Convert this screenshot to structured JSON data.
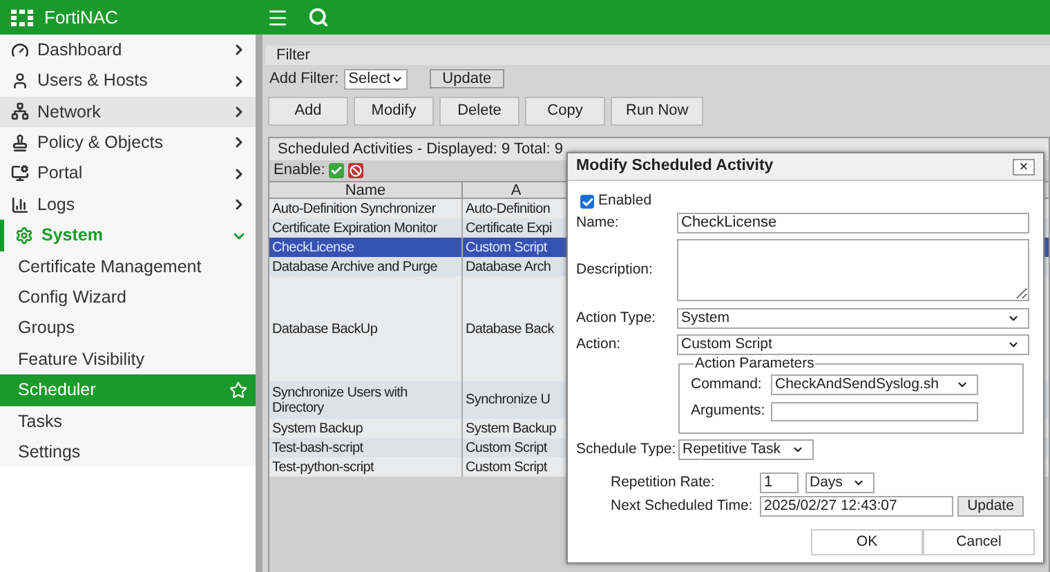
{
  "app": {
    "title": "FortiNAC"
  },
  "sidebar": {
    "items": [
      {
        "label": "Dashboard",
        "highlighted": false,
        "expanded": false
      },
      {
        "label": "Users & Hosts",
        "highlighted": false,
        "expanded": false
      },
      {
        "label": "Network",
        "highlighted": true,
        "expanded": false
      },
      {
        "label": "Policy & Objects",
        "highlighted": false,
        "expanded": false
      },
      {
        "label": "Portal",
        "highlighted": false,
        "expanded": false
      },
      {
        "label": "Logs",
        "highlighted": false,
        "expanded": false
      },
      {
        "label": "System",
        "highlighted": false,
        "expanded": true,
        "children": [
          {
            "label": "Certificate Management",
            "selected": false
          },
          {
            "label": "Config Wizard",
            "selected": false
          },
          {
            "label": "Groups",
            "selected": false
          },
          {
            "label": "Feature Visibility",
            "selected": false
          },
          {
            "label": "Scheduler",
            "selected": true
          },
          {
            "label": "Tasks",
            "selected": false
          },
          {
            "label": "Settings",
            "selected": false
          }
        ]
      }
    ]
  },
  "filter": {
    "title": "Filter",
    "add_filter_label": "Add Filter:",
    "select": "Select",
    "update_button": "Update"
  },
  "toolbar": [
    "Add",
    "Modify",
    "Delete",
    "Copy",
    "Run Now"
  ],
  "table": {
    "caption": "Scheduled Activities - Displayed: 9 Total: 9",
    "enable_label": "Enable:",
    "columns": [
      "Name",
      "A"
    ],
    "rows": [
      {
        "cells": [
          "Auto-Definition Synchronizer",
          "Auto-Definition"
        ],
        "selected": false
      },
      {
        "cells": [
          "Certificate Expiration Monitor",
          "Certificate Expi"
        ],
        "selected": false
      },
      {
        "cells": [
          "CheckLicense",
          "Custom Script"
        ],
        "selected": true
      },
      {
        "cells": [
          "Database Archive and Purge",
          "Database Arch"
        ],
        "selected": false
      },
      {
        "cells": [
          "Database BackUp",
          "Database Back"
        ],
        "selected": false
      },
      {
        "cells": [
          "Synchronize Users with Directory",
          "Synchronize U"
        ],
        "selected": false
      },
      {
        "cells": [
          "System Backup",
          "System Backup"
        ],
        "selected": false
      },
      {
        "cells": [
          "Test-bash-script",
          "Custom Script"
        ],
        "selected": false
      },
      {
        "cells": [
          "Test-python-script",
          "Custom Script"
        ],
        "selected": false
      }
    ]
  },
  "dialog": {
    "title": "Modify Scheduled Activity",
    "close": "×",
    "enabled": {
      "label": "Enabled",
      "checked": true
    },
    "name": {
      "label": "Name:",
      "value": "CheckLicense"
    },
    "description": {
      "label": "Description:"
    },
    "action_type": {
      "label": "Action Type:",
      "value": "System"
    },
    "action": {
      "label": "Action:",
      "value": "Custom Script"
    },
    "action_parameters": {
      "legend": "Action Parameters",
      "command": {
        "label": "Command:",
        "value": "CheckAndSendSyslog.sh"
      },
      "arguments": {
        "label": "Arguments:"
      }
    },
    "schedule_type": {
      "label": "Schedule Type:",
      "value": "Repetitive Task"
    },
    "repetition_rate": {
      "label": "Repetition Rate:",
      "value": "1",
      "unit": "Days"
    },
    "next_scheduled_time": {
      "label": "Next Scheduled Time:",
      "value": "2025/02/27 12:43:07",
      "update_button": "Update"
    },
    "buttons": [
      "OK",
      "Cancel"
    ]
  }
}
